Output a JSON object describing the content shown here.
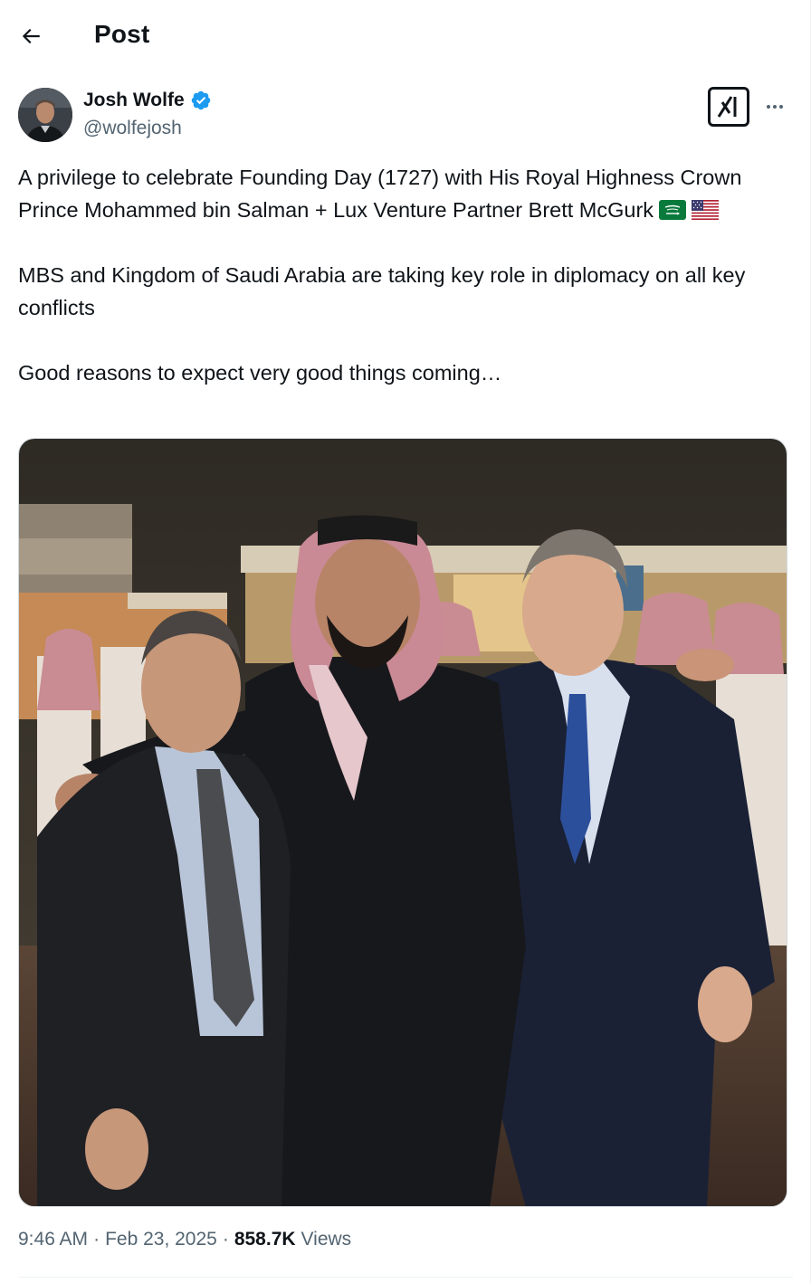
{
  "header": {
    "title": "Post"
  },
  "author": {
    "name": "Josh Wolfe",
    "handle": "@wolfejosh"
  },
  "post": {
    "paragraphs": [
      "A privilege to celebrate Founding Day (1727) with His Royal Highness Crown Prince Mohammed bin Salman + Lux Venture Partner Brett McGurk",
      "MBS and Kingdom of Saudi Arabia are taking key role in diplomacy on all key conflicts",
      "Good reasons to expect very good things coming…"
    ],
    "flags": [
      "saudi-arabia-flag",
      "united-states-flag"
    ]
  },
  "meta": {
    "time": "9:46 AM",
    "separator": "·",
    "date": "Feb 23, 2025",
    "views_count": "858.7K",
    "views_label": "Views"
  },
  "colors": {
    "text": "#0f1419",
    "secondary": "#536471",
    "verified": "#1d9bf0",
    "divider": "#eff3f4"
  },
  "icons": {
    "back": "arrow-left-icon",
    "verified": "verified-badge-icon",
    "grok": "grok-icon",
    "more": "more-horizontal-icon"
  }
}
